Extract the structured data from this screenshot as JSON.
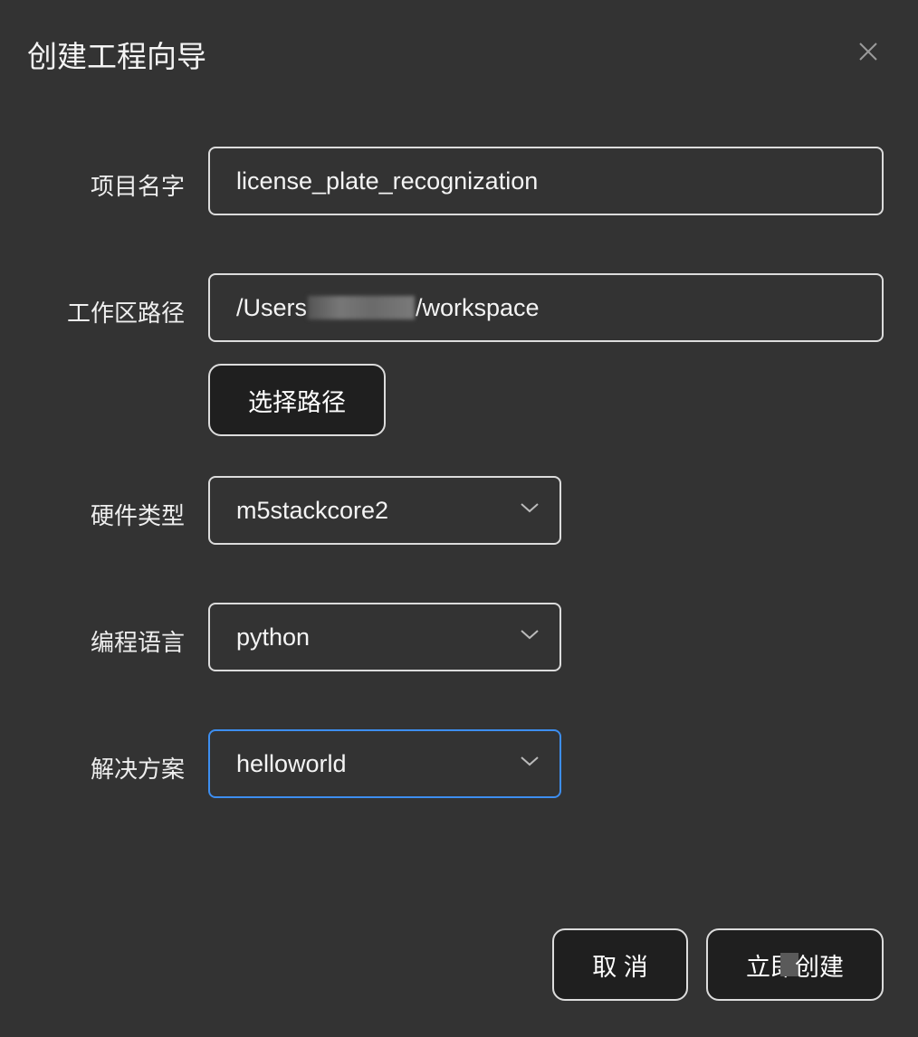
{
  "dialog": {
    "title": "创建工程向导",
    "close_icon": "close-icon"
  },
  "form": {
    "project_name": {
      "label": "项目名字",
      "value": "license_plate_recognization"
    },
    "workspace": {
      "label": "工作区路径",
      "value_prefix": "/Users",
      "value_suffix": "/workspace",
      "choose_button": "选择路径"
    },
    "hardware": {
      "label": "硬件类型",
      "value": "m5stackcore2"
    },
    "language": {
      "label": "编程语言",
      "value": "python"
    },
    "solution": {
      "label": "解决方案",
      "value": "helloworld"
    }
  },
  "footer": {
    "cancel": "取 消",
    "create_prefix": "立即",
    "create_suffix": "创建"
  },
  "colors": {
    "background": "#333333",
    "button": "#1f1f1f",
    "focus_border": "#3d8ef0"
  }
}
